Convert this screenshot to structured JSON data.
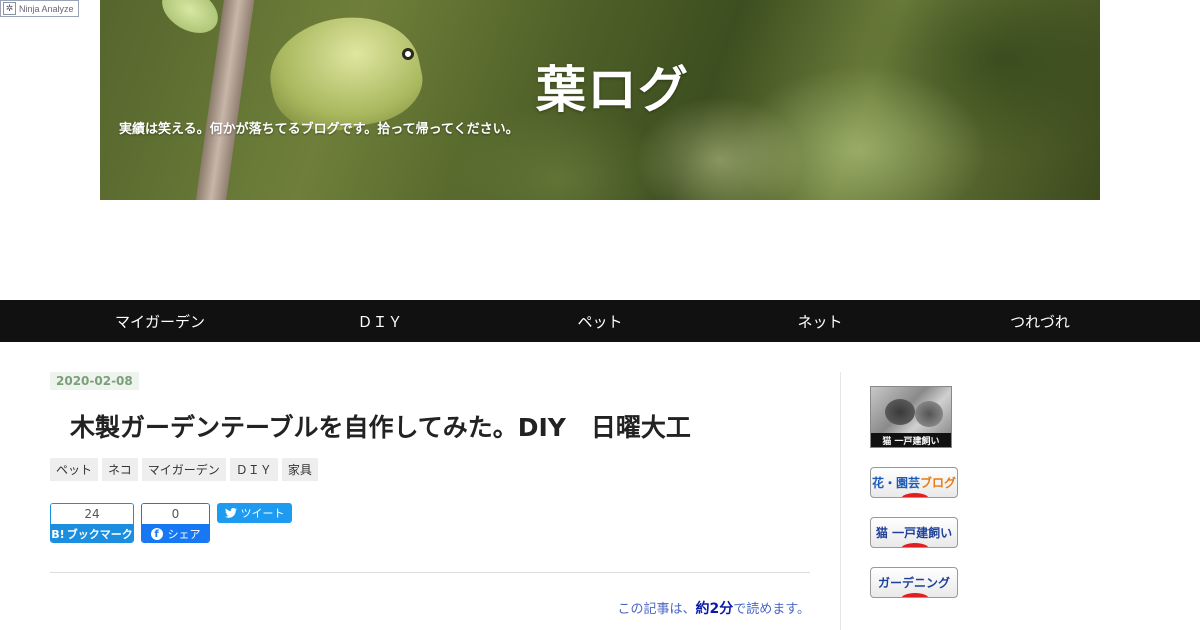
{
  "ninja": {
    "label": "Ninja Analyze"
  },
  "header": {
    "title": "葉ログ",
    "description": "実績は笑える。何かが落ちてるブログです。拾って帰ってください。"
  },
  "nav": {
    "items": [
      {
        "label": "マイガーデン"
      },
      {
        "label": "ＤＩＹ"
      },
      {
        "label": "ペット"
      },
      {
        "label": "ネット"
      },
      {
        "label": "つれづれ"
      }
    ]
  },
  "article": {
    "date": "2020-02-08",
    "title": "木製ガーデンテーブルを自作してみた。DIY　日曜大工",
    "categories": [
      "ペット",
      "ネコ",
      "マイガーデン",
      "ＤＩＹ",
      "家具"
    ],
    "share": {
      "hatena_count": "24",
      "hatena_label": "ブックマーク",
      "hatena_mark": "B!",
      "facebook_count": "0",
      "facebook_label": "シェア",
      "tweet_label": "ツイート"
    },
    "readtime": {
      "prefix": "この記事は、",
      "value": "約2分",
      "suffix": "で読めます。"
    }
  },
  "sidebar": {
    "thumb_caption": "猫 一戸建飼い",
    "banners": [
      {
        "text1": "花・園芸",
        "text2": "ブログ"
      },
      {
        "text": "猫 一戸建飼い"
      },
      {
        "text": "ガーデニング"
      }
    ]
  },
  "colors": {
    "nav_bg": "#111111",
    "date_text": "#7aa07a",
    "hatena": "#1c8ee0",
    "facebook": "#1877f2",
    "twitter": "#1d9bf0",
    "readtime_link": "#4a67c4"
  },
  "icons": {
    "ninja": "ninja-analyze-icon",
    "facebook": "facebook-icon",
    "twitter": "twitter-bird-icon"
  }
}
